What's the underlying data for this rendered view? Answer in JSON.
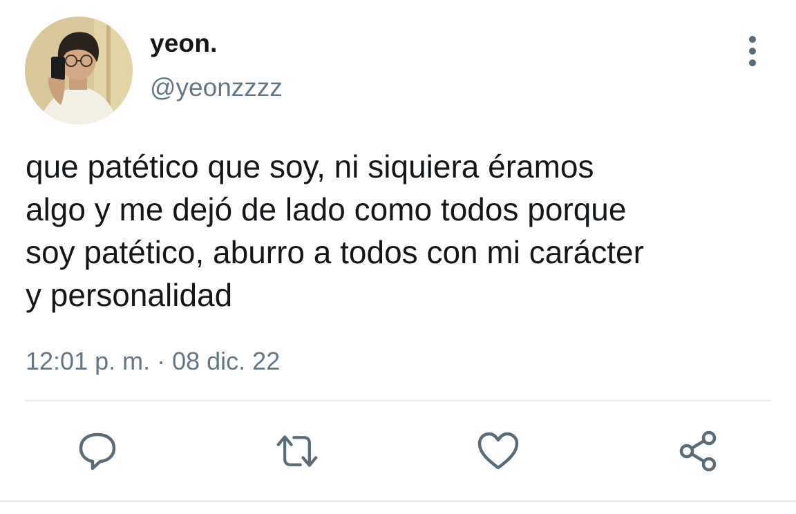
{
  "tweet": {
    "display_name": "yeon.",
    "handle": "@yeonzzzz",
    "text": "que patético que soy, ni siquiera éramos\nalgo y me dejó de lado como todos porque\nsoy patético, aburro a todos con mi carácter\ny personalidad",
    "timestamp": "12:01 p. m. · 08 dic. 22"
  },
  "icons": {
    "avatar": "profile-photo",
    "more": "more-vertical-icon",
    "reply": "reply-icon",
    "retweet": "retweet-icon",
    "like": "heart-icon",
    "share": "share-icon"
  },
  "colors": {
    "text": "#14171a",
    "secondary": "#657786",
    "icon": "#5b6b78",
    "divider": "#e6ecf0"
  }
}
